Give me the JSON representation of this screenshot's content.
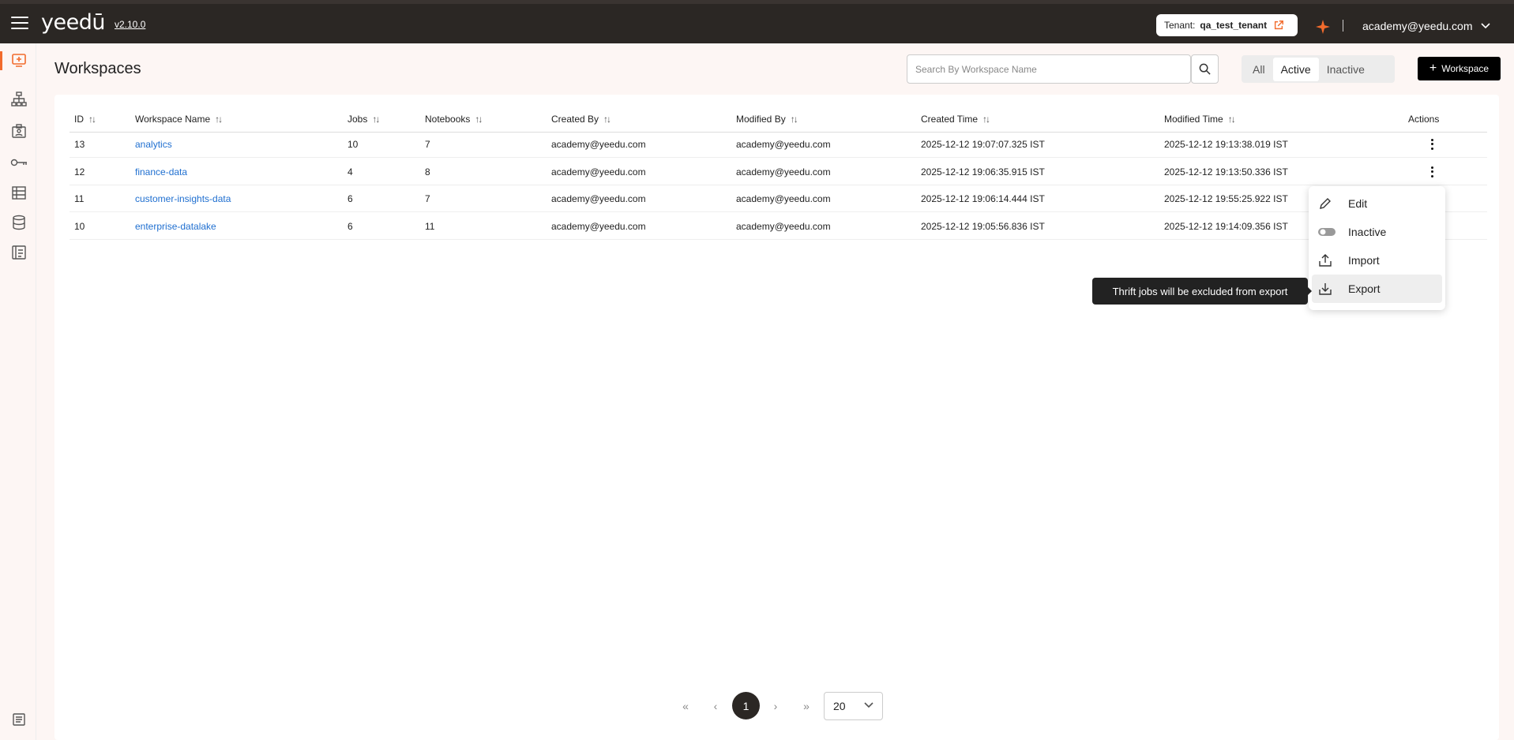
{
  "header": {
    "logo": "yeedū",
    "version": "v2.10.0",
    "tenant_label": "Tenant:",
    "tenant_name": "qa_test_tenant",
    "user": "academy@yeedu.com"
  },
  "page": {
    "title": "Workspaces",
    "search_placeholder": "Search By Workspace Name",
    "filters": [
      "All",
      "Active",
      "Inactive"
    ],
    "selected_filter": "Active",
    "add_button": "Workspace"
  },
  "table": {
    "columns": [
      "ID",
      "Workspace Name",
      "Jobs",
      "Notebooks",
      "Created By",
      "Modified By",
      "Created Time",
      "Modified Time",
      "Actions"
    ],
    "rows": [
      {
        "id": "13",
        "name": "analytics",
        "jobs": "10",
        "notebooks": "7",
        "created_by": "academy@yeedu.com",
        "modified_by": "academy@yeedu.com",
        "created_time": "2025-12-12 19:07:07.325 IST",
        "modified_time": "2025-12-12 19:13:38.019 IST"
      },
      {
        "id": "12",
        "name": "finance-data",
        "jobs": "4",
        "notebooks": "8",
        "created_by": "academy@yeedu.com",
        "modified_by": "academy@yeedu.com",
        "created_time": "2025-12-12 19:06:35.915 IST",
        "modified_time": "2025-12-12 19:13:50.336 IST"
      },
      {
        "id": "11",
        "name": "customer-insights-data",
        "jobs": "6",
        "notebooks": "7",
        "created_by": "academy@yeedu.com",
        "modified_by": "academy@yeedu.com",
        "created_time": "2025-12-12 19:06:14.444 IST",
        "modified_time": "2025-12-12 19:55:25.922 IST"
      },
      {
        "id": "10",
        "name": "enterprise-datalake",
        "jobs": "6",
        "notebooks": "11",
        "created_by": "academy@yeedu.com",
        "modified_by": "academy@yeedu.com",
        "created_time": "2025-12-12 19:05:56.836 IST",
        "modified_time": "2025-12-12 19:14:09.356 IST"
      }
    ]
  },
  "actions_menu": {
    "items": [
      "Edit",
      "Inactive",
      "Import",
      "Export"
    ],
    "hovered": "Export",
    "tooltip": "Thrift jobs will be excluded from export"
  },
  "pagination": {
    "current_page": "1",
    "page_size": "20"
  },
  "colors": {
    "topbar": "#2b2724",
    "accent": "#f26b2c",
    "link": "#1f6fd0"
  }
}
